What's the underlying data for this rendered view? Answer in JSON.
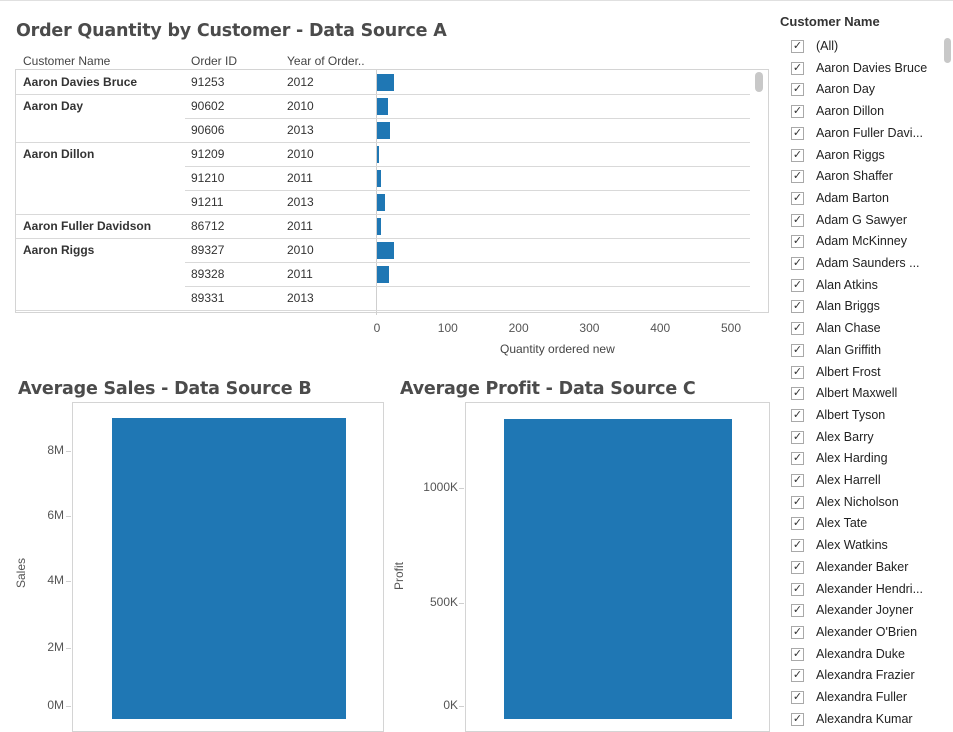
{
  "top_panel": {
    "title": "Order Quantity by Customer - Data Source A",
    "headers": {
      "customer": "Customer Name",
      "order_id": "Order ID",
      "year": "Year of Order.."
    },
    "rows": [
      {
        "customer": "Aaron Davies Bruce",
        "order_id": "91253",
        "year": "2012",
        "qty": 24
      },
      {
        "customer": "Aaron Day",
        "order_id": "90602",
        "year": "2010",
        "qty": 15
      },
      {
        "customer": "",
        "order_id": "90606",
        "year": "2013",
        "qty": 19
      },
      {
        "customer": "Aaron Dillon",
        "order_id": "91209",
        "year": "2010",
        "qty": 2
      },
      {
        "customer": "",
        "order_id": "91210",
        "year": "2011",
        "qty": 5
      },
      {
        "customer": "",
        "order_id": "91211",
        "year": "2013",
        "qty": 12
      },
      {
        "customer": "Aaron Fuller Davidson",
        "order_id": "86712",
        "year": "2011",
        "qty": 5
      },
      {
        "customer": "Aaron Riggs",
        "order_id": "89327",
        "year": "2010",
        "qty": 24
      },
      {
        "customer": "",
        "order_id": "89328",
        "year": "2011",
        "qty": 17
      },
      {
        "customer": "",
        "order_id": "89331",
        "year": "2013",
        "qty": 0
      }
    ],
    "x_ticks": [
      "0",
      "100",
      "200",
      "300",
      "400",
      "500"
    ],
    "x_label": "Quantity ordered new",
    "bar_color": "#1f77b4"
  },
  "sales_panel": {
    "title": "Average Sales - Data Source B",
    "y_label": "Sales",
    "y_ticks": [
      "8M",
      "6M",
      "4M",
      "2M",
      "0M"
    ],
    "chart_data": {
      "type": "bar",
      "categories": [
        ""
      ],
      "values": [
        9000000
      ],
      "ylabel": "Sales",
      "ylim": [
        0,
        9000000
      ]
    }
  },
  "profit_panel": {
    "title": "Average Profit - Data Source C",
    "y_label": "Profit",
    "y_ticks": [
      "1000K",
      "500K",
      "0K"
    ],
    "chart_data": {
      "type": "bar",
      "categories": [
        ""
      ],
      "values": [
        1300000
      ],
      "ylabel": "Profit",
      "ylim": [
        0,
        1300000
      ]
    }
  },
  "filter": {
    "title": "Customer Name",
    "check_glyph": "✓",
    "items": [
      "(All)",
      "Aaron Davies Bruce",
      "Aaron Day",
      "Aaron Dillon",
      "Aaron Fuller Davi...",
      "Aaron Riggs",
      "Aaron Shaffer",
      "Adam Barton",
      "Adam G Sawyer",
      "Adam McKinney",
      "Adam Saunders ...",
      "Alan Atkins",
      "Alan Briggs",
      "Alan Chase",
      "Alan Griffith",
      "Albert Frost",
      "Albert Maxwell",
      "Albert Tyson",
      "Alex Barry",
      "Alex Harding",
      "Alex Harrell",
      "Alex Nicholson",
      "Alex Tate",
      "Alex Watkins",
      "Alexander Baker",
      "Alexander Hendri...",
      "Alexander Joyner",
      "Alexander O'Brien",
      "Alexandra Duke",
      "Alexandra Frazier",
      "Alexandra Fuller",
      "Alexandra Kumar"
    ]
  }
}
